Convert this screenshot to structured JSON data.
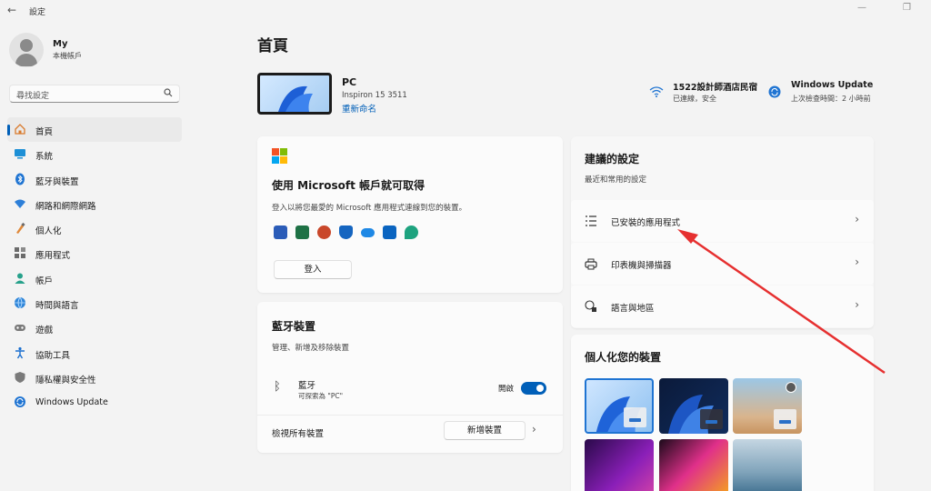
{
  "window": {
    "title": "設定"
  },
  "profile": {
    "name": "My",
    "account_type": "本機帳戶"
  },
  "search": {
    "placeholder": "尋找設定"
  },
  "sidebar": {
    "items": [
      {
        "label": "首頁",
        "icon": "home-icon"
      },
      {
        "label": "系統",
        "icon": "system-icon"
      },
      {
        "label": "藍牙與裝置",
        "icon": "bluetooth-icon"
      },
      {
        "label": "網路和網際網路",
        "icon": "network-icon"
      },
      {
        "label": "個人化",
        "icon": "personalization-icon"
      },
      {
        "label": "應用程式",
        "icon": "apps-icon"
      },
      {
        "label": "帳戶",
        "icon": "account-icon"
      },
      {
        "label": "時間與語言",
        "icon": "time-language-icon"
      },
      {
        "label": "遊戲",
        "icon": "gaming-icon"
      },
      {
        "label": "協助工具",
        "icon": "accessibility-icon"
      },
      {
        "label": "隱私權與安全性",
        "icon": "shield-icon"
      },
      {
        "label": "Windows Update",
        "icon": "windows-update-icon"
      }
    ]
  },
  "main": {
    "title": "首頁",
    "pc": {
      "name": "PC",
      "model": "Inspiron 15 3511",
      "rename": "重新命名"
    },
    "wifi": {
      "name": "1522設計師酒店民宿",
      "status": "已連線，安全"
    },
    "update": {
      "name": "Windows Update",
      "status": "上次檢查時間：2 小時前"
    },
    "ms_account": {
      "title": "使用 Microsoft 帳戶就可取得",
      "desc": "登入以將您最愛的 Microsoft 應用程式連線到您的裝置。",
      "signin": "登入"
    },
    "bluetooth": {
      "title": "藍牙裝置",
      "desc": "管理、新增及移除裝置",
      "device_name": "藍牙",
      "device_status": "可探索為 \"PC\"",
      "toggle_label": "開啟",
      "view_all": "檢視所有裝置",
      "add_device": "新增裝置"
    },
    "recommended": {
      "title": "建議的設定",
      "subtitle": "最近和常用的設定",
      "items": [
        {
          "label": "已安裝的應用程式",
          "icon": "installed-apps-icon"
        },
        {
          "label": "印表機與掃描器",
          "icon": "printer-icon"
        },
        {
          "label": "語言與地區",
          "icon": "language-region-icon"
        }
      ]
    },
    "personalize": {
      "title": "個人化您的裝置"
    }
  },
  "colors": {
    "accent": "#005fb8",
    "annotation_arrow": "#e63030"
  }
}
